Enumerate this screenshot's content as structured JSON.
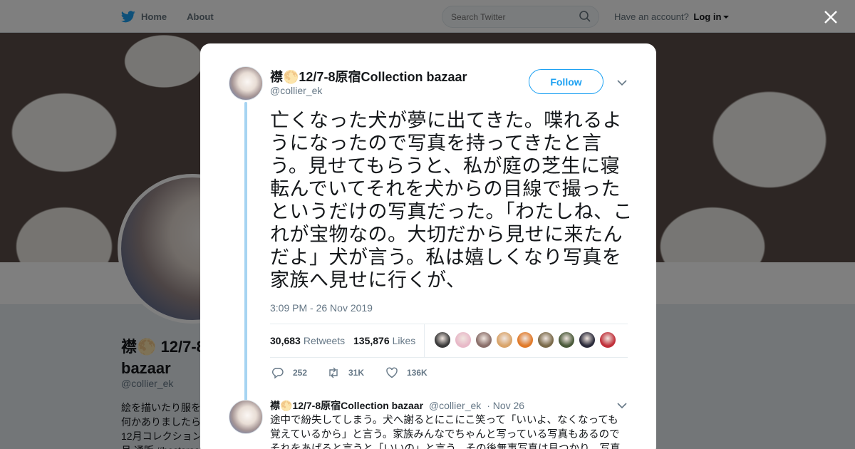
{
  "nav": {
    "home_label": "Home",
    "about_label": "About",
    "search_placeholder": "Search Twitter",
    "account_prompt": "Have an account?",
    "login_label": "Log in"
  },
  "profile": {
    "name_line1": "襟🌕 12/7-8",
    "name_line2": "bazaar",
    "handle": "@collier_ek",
    "bio_lines": [
      "絵を描いたり服を",
      "何かありましたら",
      "12月コレクション",
      "月 通販 #bestsrsa"
    ]
  },
  "tweet": {
    "author_name": "襟🌕12/7-8原宿Collection bazaar",
    "author_handle": "@collier_ek",
    "follow_label": "Follow",
    "text": "亡くなった犬が夢に出てきた。喋れるようになったので写真を持ってきたと言う。見せてもらうと、私が庭の芝生に寝転んでいてそれを犬からの目線で撮ったというだけの写真だった。「わたしね、これが宝物なの。大切だから見せに来たんだよ」犬が言う。私は嬉しくなり写真を家族へ見せに行くが、",
    "timestamp": "3:09 PM - 26 Nov 2019",
    "retweets_count": "30,683",
    "retweets_label": "Retweets",
    "likes_count": "135,876",
    "likes_label": "Likes",
    "liker_colors": [
      "#3b3b3b",
      "#e8b9c8",
      "#8a6f6a",
      "#d9a46a",
      "#e07a2a",
      "#7a6a4a",
      "#4a5a3a",
      "#2a2a3a",
      "#c0303a"
    ],
    "reply_count": "252",
    "retweet_action_count": "31K",
    "like_action_count": "136K"
  },
  "reply": {
    "author_name": "襟🌕12/7-8原宿Collection bazaar",
    "author_handle": "@collier_ek",
    "date": "· Nov 26",
    "text": "途中で紛失してしまう。犬へ謝るとにこにこ笑って「いいよ、なくなっても覚えているから」と言う。家族みんなでちゃんと写っている写真もあるのでそれをあげると言うと「いいの」と言う。その後無事写真は見つかり、写真を犬に"
  }
}
